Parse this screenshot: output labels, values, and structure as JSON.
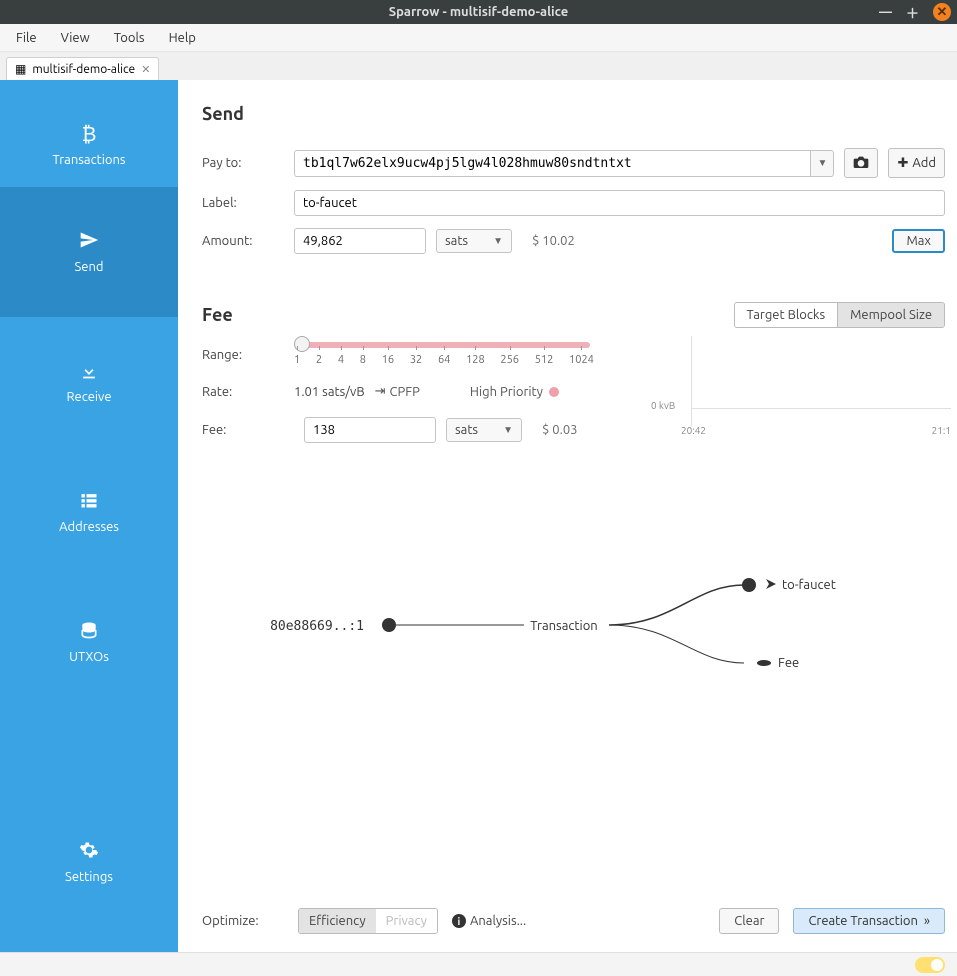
{
  "window": {
    "title": "Sparrow - multisif-demo-alice"
  },
  "menu": {
    "file": "File",
    "view": "View",
    "tools": "Tools",
    "help": "Help"
  },
  "tab": {
    "name": "multisif-demo-alice"
  },
  "sidebar": {
    "transactions": "Transactions",
    "send": "Send",
    "receive": "Receive",
    "addresses": "Addresses",
    "utxos": "UTXOs",
    "settings": "Settings"
  },
  "send": {
    "heading": "Send",
    "payto_label": "Pay to:",
    "payto_value": "tb1ql7w62elx9ucw4pj5lgw4l028hmuw80sndtntxt",
    "add_btn": "Add",
    "label_label": "Label:",
    "label_value": "to-faucet",
    "amount_label": "Amount:",
    "amount_value": "49,862",
    "amount_unit": "sats",
    "amount_usd": "$ 10.02",
    "max_btn": "Max"
  },
  "fee": {
    "heading": "Fee",
    "target_blocks": "Target Blocks",
    "mempool_size": "Mempool Size",
    "range_label": "Range:",
    "ticks": [
      "1",
      "2",
      "4",
      "8",
      "16",
      "32",
      "64",
      "128",
      "256",
      "512",
      "1024"
    ],
    "rate_label": "Rate:",
    "rate_value": "1.01 sats/vB",
    "cpfp": "CPFP",
    "priority": "High Priority",
    "fee_label": "Fee:",
    "fee_value": "138",
    "fee_unit": "sats",
    "fee_usd": "$ 0.03",
    "chart_y": "0 kvB",
    "chart_x1": "20:42",
    "chart_x2": "21:1"
  },
  "diagram": {
    "input": "80e88669..:1",
    "center": "Transaction",
    "out1": "to-faucet",
    "out2": "Fee"
  },
  "optimize": {
    "label": "Optimize:",
    "efficiency": "Efficiency",
    "privacy": "Privacy",
    "analysis": "Analysis...",
    "clear": "Clear",
    "create": "Create Transaction"
  }
}
